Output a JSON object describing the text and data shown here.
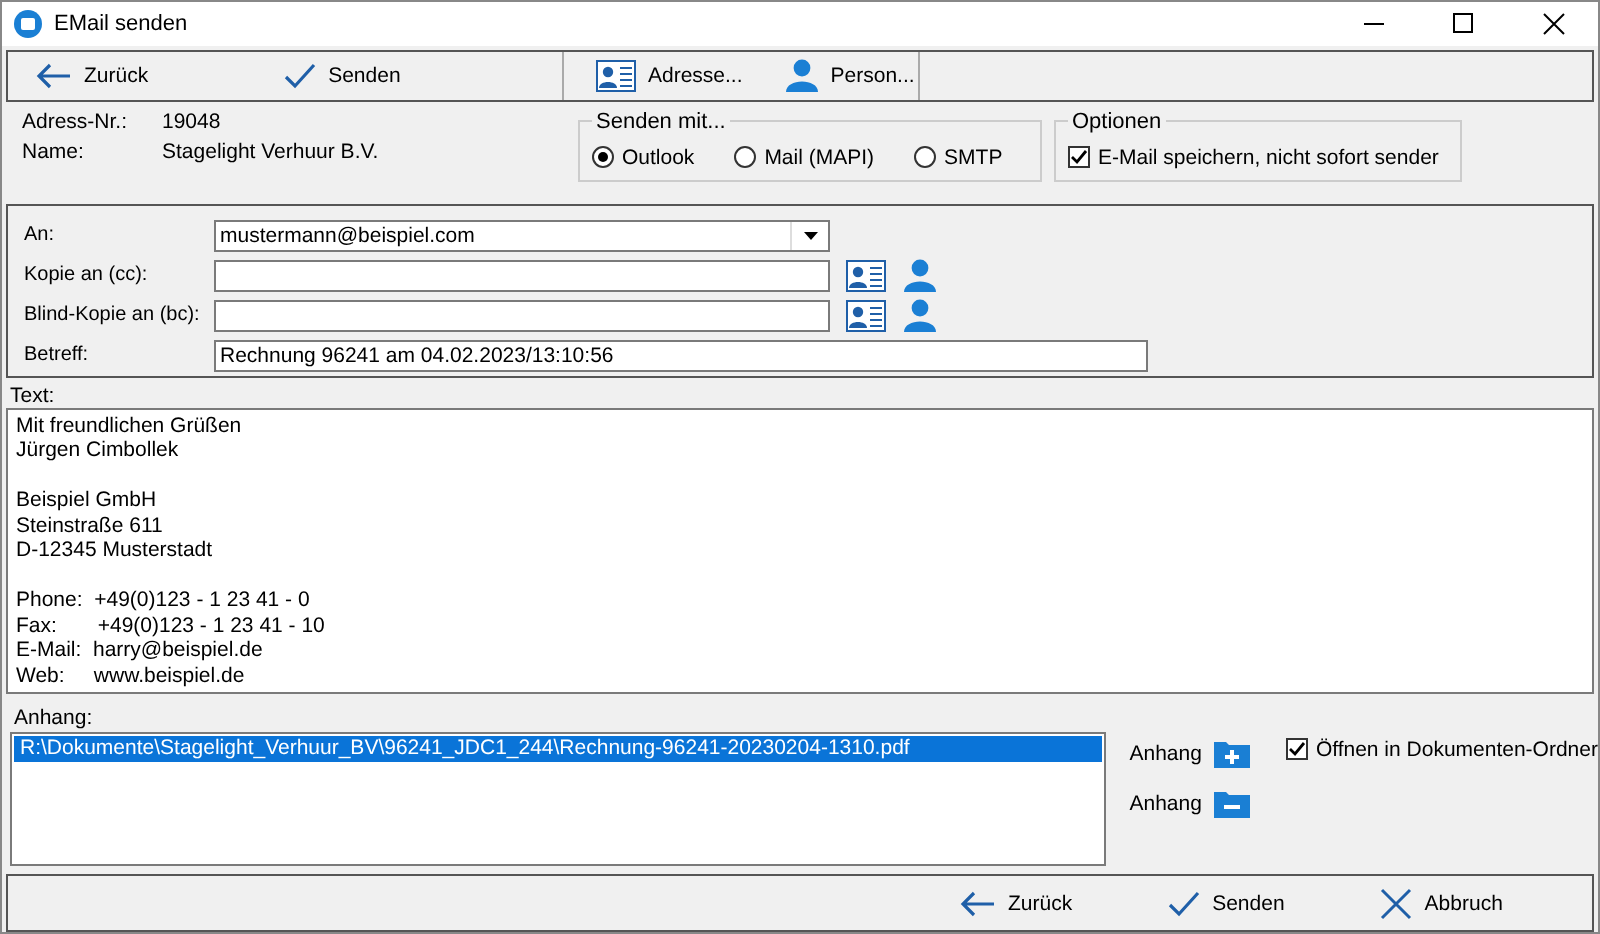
{
  "window": {
    "title": "EMail senden"
  },
  "toolbar": [
    {
      "label": "Zurück",
      "kind": "back"
    },
    {
      "label": "Senden",
      "kind": "check"
    },
    {
      "label": "Adresse...",
      "kind": "card"
    },
    {
      "label": "Person...",
      "kind": "person"
    }
  ],
  "address": [
    {
      "label": "Adress-Nr.:",
      "value": "19048"
    },
    {
      "label": "Name:",
      "value": "Stagelight Verhuur B.V."
    }
  ],
  "send_with": {
    "title": "Senden mit...",
    "options": [
      {
        "label": "Outlook",
        "selected": true
      },
      {
        "label": "Mail (MAPI)",
        "selected": false
      },
      {
        "label": "SMTP",
        "selected": false
      }
    ]
  },
  "options": {
    "title": "Optionen",
    "items": [
      {
        "label": "E-Mail speichern, nicht sofort sender",
        "checked": true
      }
    ]
  },
  "recipients": [
    {
      "label": "An:",
      "value": "mustermann@beispiel.com",
      "kind": "dropdown"
    },
    {
      "label": "Kopie an (cc):",
      "kind": "lookup"
    },
    {
      "label": "Blind-Kopie an (bc):",
      "kind": "lookup"
    },
    {
      "label": "Betreff:",
      "value": "Rechnung 96241 am 04.02.2023/13:10:56",
      "kind": "wide"
    }
  ],
  "text": {
    "label": "Text:",
    "value": "Mit freundlichen Grüßen\nJürgen Cimbollek\n\nBeispiel GmbH\nSteinstraße 611\nD-12345 Musterstadt\n\nPhone:  +49(0)123 - 1 23 41 - 0\nFax:       +49(0)123 - 1 23 41 - 10\nE-Mail:  harry@beispiel.de\nWeb:     www.beispiel.de"
  },
  "attachments": {
    "label": "Anhang:",
    "items": [
      {
        "path": "R:\\Dokumente\\Stagelight_Verhuur_BV\\96241_JDC1_244\\Rechnung-96241-20230204-1310.pdf",
        "selected": true
      }
    ],
    "buttons": [
      {
        "label": "Anhang",
        "kind": "plus"
      },
      {
        "label": "Anhang",
        "kind": "minus"
      }
    ],
    "open_in_folder": {
      "label": "Öffnen in Dokumenten-Ordner",
      "checked": true
    }
  },
  "footer": [
    {
      "label": "Zurück",
      "kind": "back"
    },
    {
      "label": "Senden",
      "kind": "check"
    },
    {
      "label": "Abbruch",
      "kind": "cross"
    }
  ]
}
